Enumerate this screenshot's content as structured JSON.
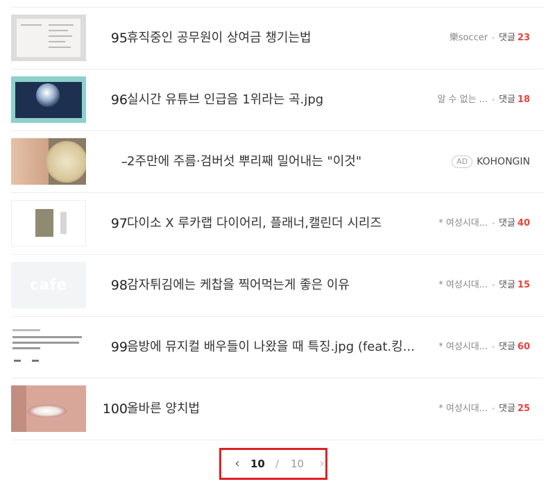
{
  "rows": [
    {
      "rank": "95",
      "title": "휴직중인 공무원이 상여금 챙기는법",
      "source": "樂soccer",
      "comment_label": "댓글",
      "comment_count": "23"
    },
    {
      "rank": "96",
      "title": "실시간 유튜브 인급음 1위라는 곡.jpg",
      "source": "알 수 없는 ...",
      "comment_label": "댓글",
      "comment_count": "18"
    },
    {
      "rank": "–",
      "title": "2주만에 주름·검버섯 뿌리째 밀어내는 \"이것\"",
      "ad_badge": "AD",
      "advertiser": "KOHONGIN"
    },
    {
      "rank": "97",
      "title": "다이소 X 루카랩 다이어리, 플래너,캘린더 시리즈",
      "source": "* 여성시대...",
      "comment_label": "댓글",
      "comment_count": "40"
    },
    {
      "rank": "98",
      "title": "감자튀김에는 케찹을 찍어먹는게 좋은 이유",
      "source": "* 여성시대...",
      "comment_label": "댓글",
      "comment_count": "15"
    },
    {
      "rank": "99",
      "title": "음방에 뮤지컬 배우들이 나왔을 때 특징.jpg (feat.킹...",
      "source": "* 여성시대...",
      "comment_label": "댓글",
      "comment_count": "60"
    },
    {
      "rank": "100",
      "title": "올바른 양치법",
      "source": "* 여성시대...",
      "comment_label": "댓글",
      "comment_count": "25"
    }
  ],
  "thumb_text": {
    "cafe": "cafe"
  },
  "pagination": {
    "prev_icon": "‹",
    "current": "10",
    "separator": "/",
    "total": "10",
    "next_icon": "›"
  },
  "colors": {
    "comment_count": "#e8413c",
    "pager_highlight": "#e02020"
  }
}
